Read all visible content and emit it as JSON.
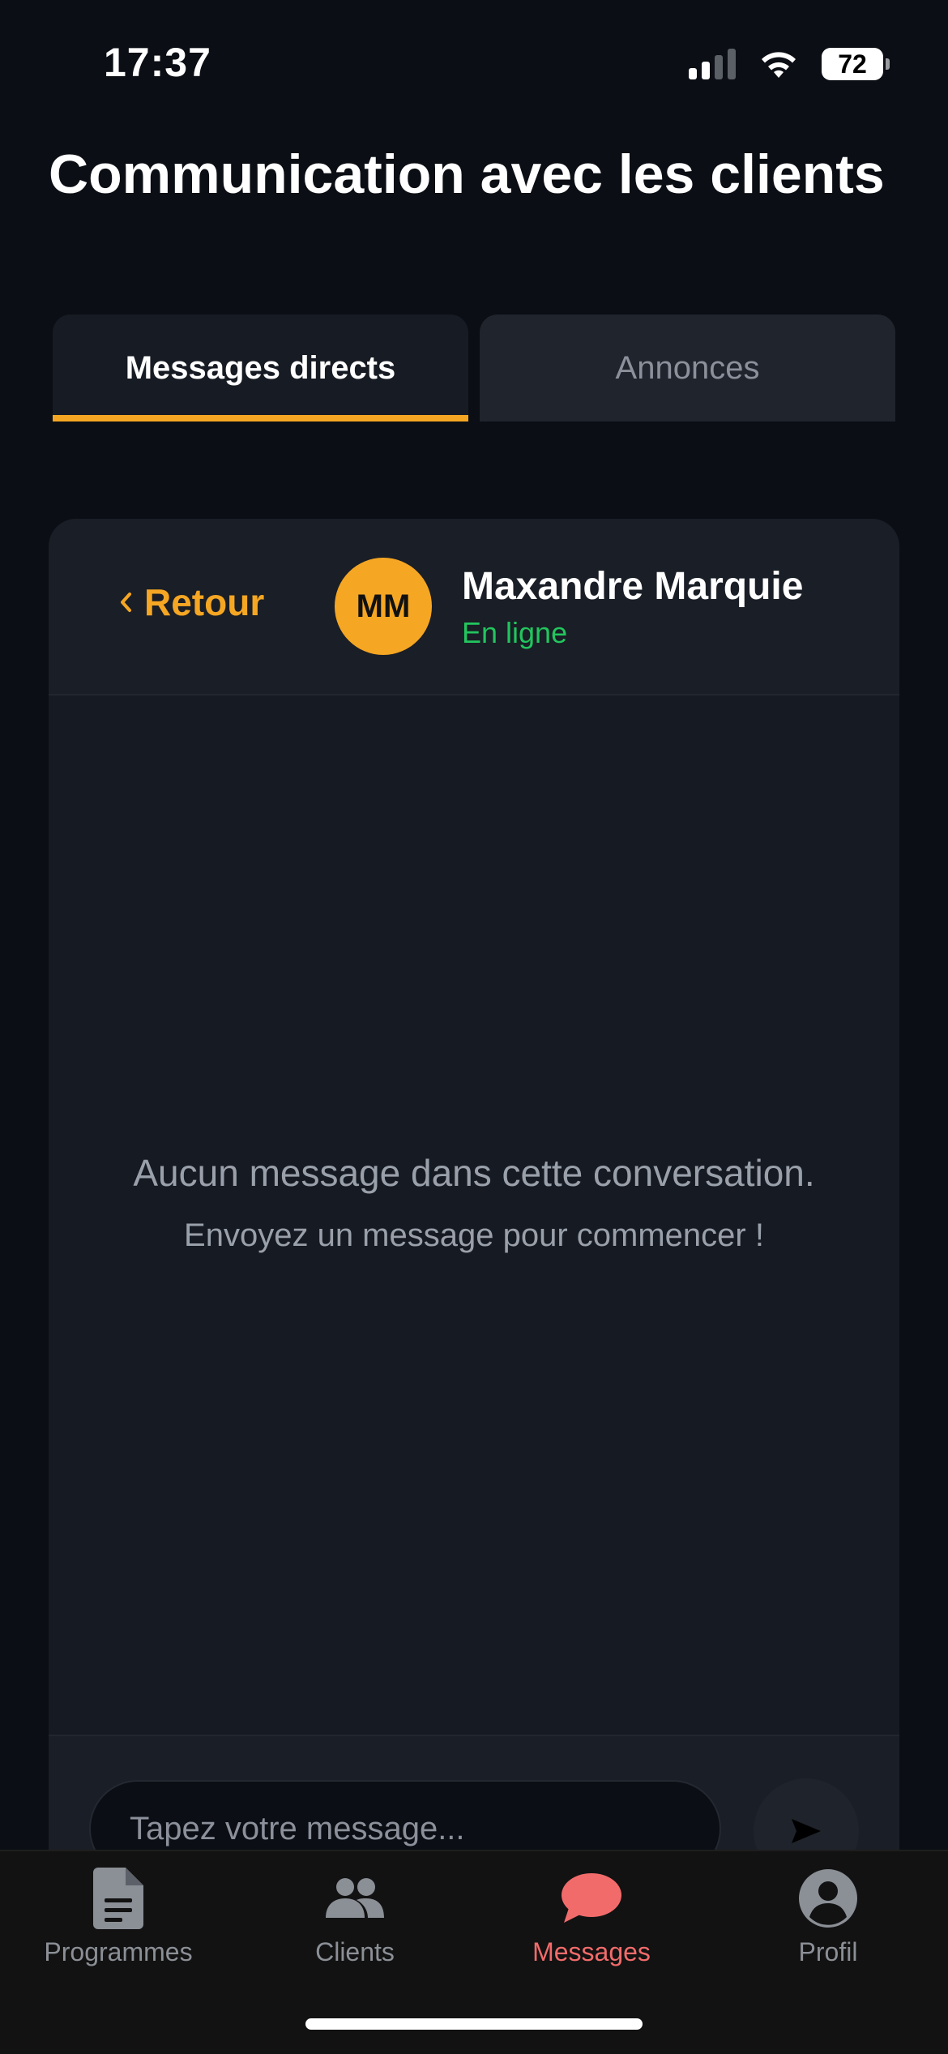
{
  "status_bar": {
    "time": "17:37",
    "battery": "72"
  },
  "page": {
    "title": "Communication avec les clients"
  },
  "tabs": [
    {
      "label": "Messages directs",
      "active": true
    },
    {
      "label": "Annonces",
      "active": false
    }
  ],
  "chat": {
    "back_label": "Retour",
    "back_icon": "chevron-left-icon",
    "contact": {
      "initials": "MM",
      "name": "Maxandre Marquie",
      "status": "En ligne"
    },
    "empty_title": "Aucun message dans cette conversation.",
    "empty_subtitle": "Envoyez un message pour commencer !",
    "input_placeholder": "Tapez votre message...",
    "send_icon": "send-arrow-icon"
  },
  "bottom_nav": [
    {
      "label": "Programmes",
      "icon": "document-icon",
      "active": false
    },
    {
      "label": "Clients",
      "icon": "users-icon",
      "active": false
    },
    {
      "label": "Messages",
      "icon": "chat-bubble-icon",
      "active": true
    },
    {
      "label": "Profil",
      "icon": "user-circle-icon",
      "active": false
    }
  ],
  "colors": {
    "accent": "#f5a623",
    "online": "#22c55e",
    "nav_active": "#f26b6b",
    "background": "#0b0e14"
  }
}
